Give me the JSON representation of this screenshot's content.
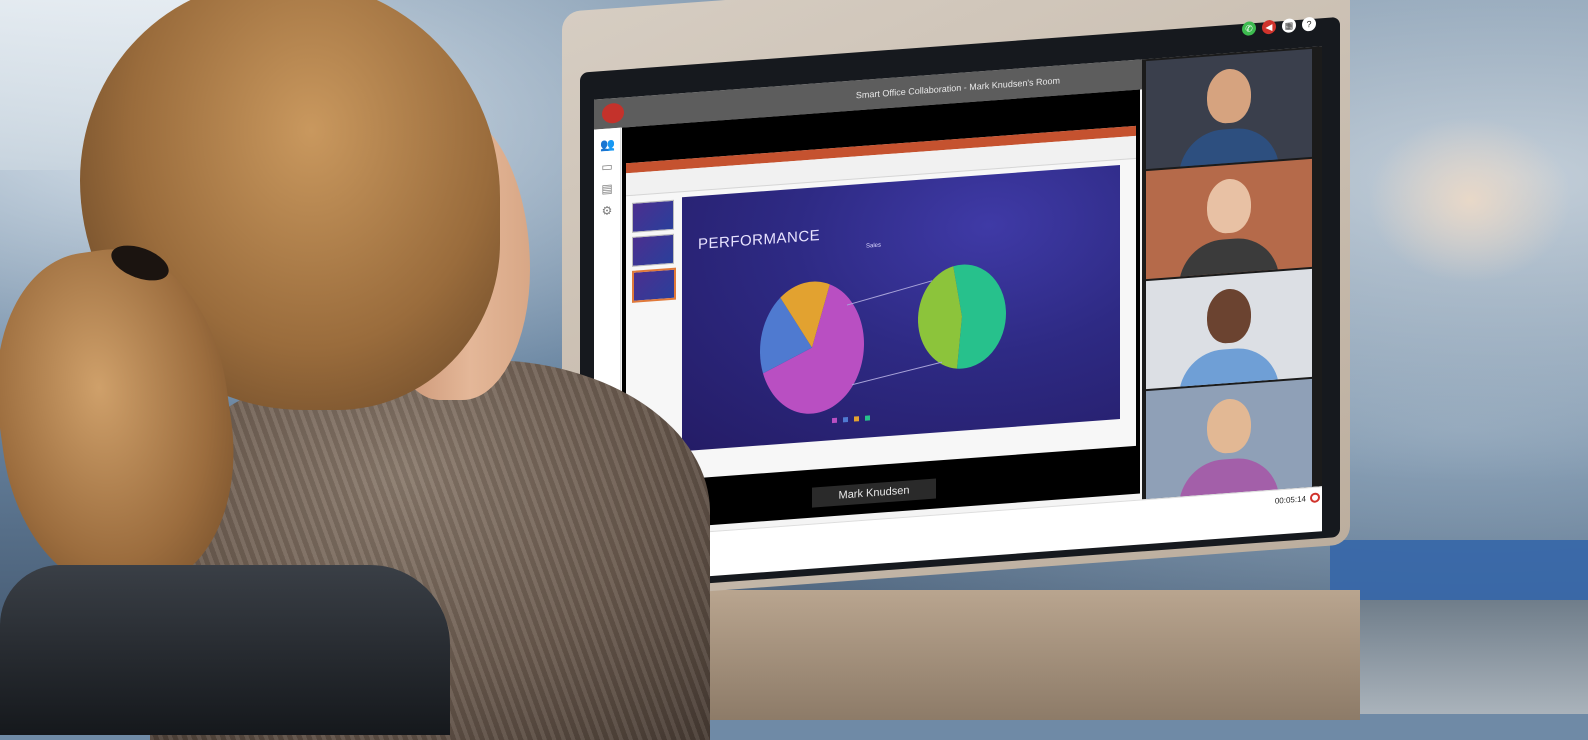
{
  "window": {
    "title": "Smart Office Collaboration - Mark Knudsen's Room"
  },
  "window_controls": [
    {
      "name": "phone-icon",
      "glyph": "✆",
      "color": "#3dbb4f"
    },
    {
      "name": "speaker-icon",
      "glyph": "◀",
      "color": "#d0332c"
    },
    {
      "name": "grid-icon",
      "glyph": "▦",
      "color": "#ffffff"
    },
    {
      "name": "help-icon",
      "glyph": "?",
      "color": "#ffffff"
    }
  ],
  "left_rail": [
    {
      "name": "participants-icon",
      "glyph": "👥"
    },
    {
      "name": "screen-share-icon",
      "glyph": "▭"
    },
    {
      "name": "layout-icon",
      "glyph": "▤"
    },
    {
      "name": "gear-icon",
      "glyph": "⚙"
    }
  ],
  "slide": {
    "title": "PERFORMANCE"
  },
  "chart_data": {
    "type": "pie",
    "title": "Sales",
    "charts": [
      {
        "name": "main-pie",
        "slices": [
          {
            "label": "",
            "value": 64,
            "color": "#b94fc2"
          },
          {
            "label": "",
            "value": 20,
            "color": "#4f7ad0"
          },
          {
            "label": "",
            "value": 16,
            "color": "#e2a230"
          }
        ]
      },
      {
        "name": "secondary-pie",
        "slices": [
          {
            "label": "",
            "value": 55,
            "color": "#27c18c"
          },
          {
            "label": "",
            "value": 45,
            "color": "#8cc43b"
          }
        ]
      }
    ],
    "legend_placement": "bottom"
  },
  "speaker": {
    "name": "Mark Knudsen"
  },
  "bottom_toolbar": {
    "tools": [
      {
        "name": "mic-icon",
        "glyph": "●"
      },
      {
        "name": "camera-icon",
        "glyph": "■"
      },
      {
        "name": "share-icon",
        "glyph": "▲"
      },
      {
        "name": "chat-icon",
        "glyph": "✎"
      },
      {
        "name": "notes-icon",
        "glyph": "▣"
      }
    ],
    "timer": "00:05:14"
  },
  "participants": [
    {
      "name": "participant-1",
      "skin": "#d6a37f",
      "shirt": "#2d4f7f",
      "bg": "#3a3f4c"
    },
    {
      "name": "participant-2",
      "skin": "#e8c1a4",
      "shirt": "#3b3b3b",
      "bg": "#b56a4a"
    },
    {
      "name": "participant-3",
      "skin": "#6b4330",
      "shirt": "#6f9fd6",
      "bg": "#dcdfe4"
    },
    {
      "name": "participant-4",
      "skin": "#e2b894",
      "shirt": "#a35fa9",
      "bg": "#8fa0b7"
    }
  ],
  "colors": {
    "accent": "#c4322b",
    "titlebar": "#5d5d5d",
    "slide_bg": "#2e2a84"
  }
}
